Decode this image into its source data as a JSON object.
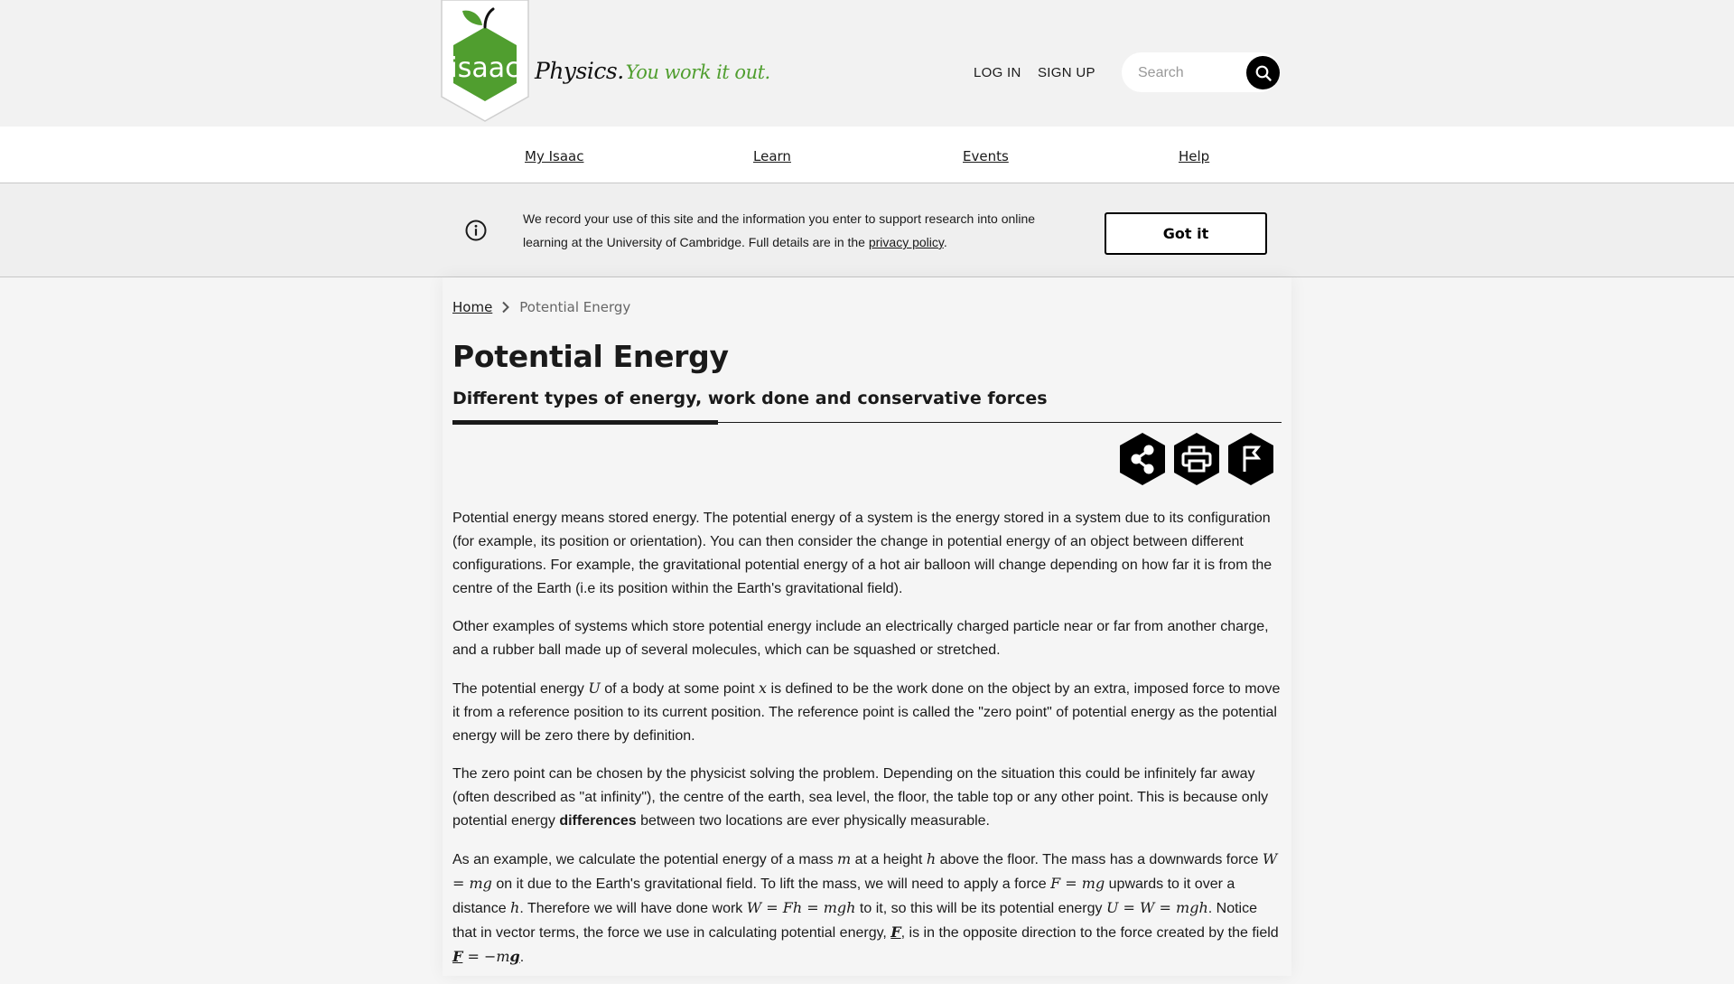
{
  "header": {
    "logo_text": "isaac",
    "wordmark_main": "Physics.",
    "wordmark_tagline": "You work it out.",
    "login_label": "LOG IN",
    "signup_label": "SIGN UP",
    "search_placeholder": "Search",
    "search_value": ""
  },
  "nav": {
    "items": [
      {
        "label": "My Isaac"
      },
      {
        "label": "Learn"
      },
      {
        "label": "Events"
      },
      {
        "label": "Help"
      }
    ]
  },
  "banner": {
    "text_before": "We record your use of this site and the information you enter to support research into online learning at the University of Cambridge. Full details are in the ",
    "link_label": "privacy policy",
    "text_after": ".",
    "button_label": "Got it"
  },
  "breadcrumb": {
    "home": "Home",
    "current": "Potential Energy"
  },
  "page": {
    "title": "Potential Energy",
    "subtitle": "Different types of energy, work done and conservative forces",
    "actions": [
      "share-icon",
      "print-icon",
      "flag-icon"
    ]
  },
  "body": {
    "p1": "Potential energy means stored energy. The potential energy of a system is the energy stored in a system due to its configuration (for example, its position or orientation). You can then consider the change in potential energy of an object between different configurations. For example, the gravitational potential energy of a hot air balloon will change depending on how far it is from the centre of the Earth (i.e its position within the Earth's gravitational field).",
    "p2": "Other examples of systems which store potential energy include an electrically charged particle near or far from another charge, and a rubber ball made up of several molecules, which can be squashed or stretched.",
    "p3": {
      "t1": "The potential energy ",
      "m1": "U",
      "t2": " of a body at some point ",
      "m2": "x",
      "t3": " is defined to be the work done on the object by an extra, imposed force to move it from a reference position to its current position. The reference point is called the \"zero point\" of potential energy as the potential energy will be zero there by definition."
    },
    "p4": {
      "t1": "The zero point can be chosen by the physicist solving the problem. Depending on the situation this could be infinitely far away (often described as \"at infinity\"), the centre of the earth, sea level, the floor, the table top or any other point. This is because only potential energy ",
      "bold": "differences",
      "t2": " between two locations are ever physically measurable."
    },
    "p5": {
      "t1": "As an example, we calculate the potential energy of a mass ",
      "m1": "m",
      "t2": " at a height ",
      "m2": "h",
      "t3": " above the floor. The mass has a downwards force ",
      "m3": "W = mg",
      "t4": " on it due to the Earth's gravitational field. To lift the mass, we will need to apply a force ",
      "m4": "F = mg",
      "t5": " upwards to it over a distance ",
      "m5": "h",
      "t6": ". Therefore we will have done work ",
      "m6": "W = Fh = mgh",
      "t7": " to it, so this will be its potential energy ",
      "m7": "U = W = mgh",
      "t8": ". Notice that in vector terms, the force we use in calculating potential energy, ",
      "v1": "F",
      "t9": ", is in the opposite direction to the force created by the field ",
      "v2": "F",
      "m8": " = −m",
      "v3": "g",
      "t10": "."
    }
  },
  "colors": {
    "brand_green": "#509e2f",
    "text": "#1a1a1a",
    "hex_icon_bg": "#000000"
  }
}
